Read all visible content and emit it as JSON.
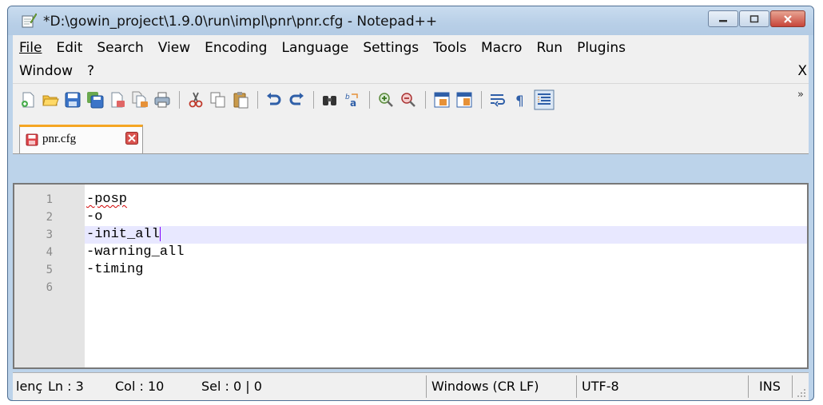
{
  "window": {
    "title": "*D:\\gowin_project\\1.9.0\\run\\impl\\pnr\\pnr.cfg - Notepad++",
    "controls": {
      "minimize": "minimize",
      "maximize": "maximize",
      "close": "close"
    }
  },
  "menu": {
    "row1": [
      "File",
      "Edit",
      "Search",
      "View",
      "Encoding",
      "Language",
      "Settings",
      "Tools",
      "Macro",
      "Run",
      "Plugins"
    ],
    "row2": [
      "Window",
      "?"
    ],
    "close_doc": "X"
  },
  "toolbar": {
    "icons": [
      "new-icon",
      "open-icon",
      "save-icon",
      "save-all-icon",
      "close-icon",
      "close-all-icon",
      "print-icon",
      "cut-icon",
      "copy-icon",
      "paste-icon",
      "undo-icon",
      "redo-icon",
      "find-icon",
      "replace-icon",
      "zoom-in-icon",
      "zoom-out-icon",
      "sync-vertical-icon",
      "sync-horizontal-icon",
      "word-wrap-icon",
      "show-all-chars-icon",
      "indent-guide-icon"
    ],
    "overflow": "»"
  },
  "tabs": [
    {
      "label": "pnr.cfg",
      "modified": true
    }
  ],
  "editor": {
    "current_line": 3,
    "lines": [
      {
        "number": "1",
        "text": "-posp"
      },
      {
        "number": "2",
        "text": "-o"
      },
      {
        "number": "3",
        "text": "-init_all"
      },
      {
        "number": "4",
        "text": "-warning_all"
      },
      {
        "number": "5",
        "text": "-timing"
      },
      {
        "number": "6",
        "text": ""
      }
    ]
  },
  "status": {
    "length": "lenç",
    "ln": "Ln : 3",
    "col": "Col : 10",
    "sel": "Sel : 0 | 0",
    "eol": "Windows (CR LF)",
    "encoding": "UTF-8",
    "mode": "INS"
  },
  "colors": {
    "title_bar": "#bcd3ea",
    "current_line": "#e8e8ff",
    "gutter": "#e4e4e4",
    "tab_accent": "#f5a623",
    "caret": "#8000ff"
  }
}
